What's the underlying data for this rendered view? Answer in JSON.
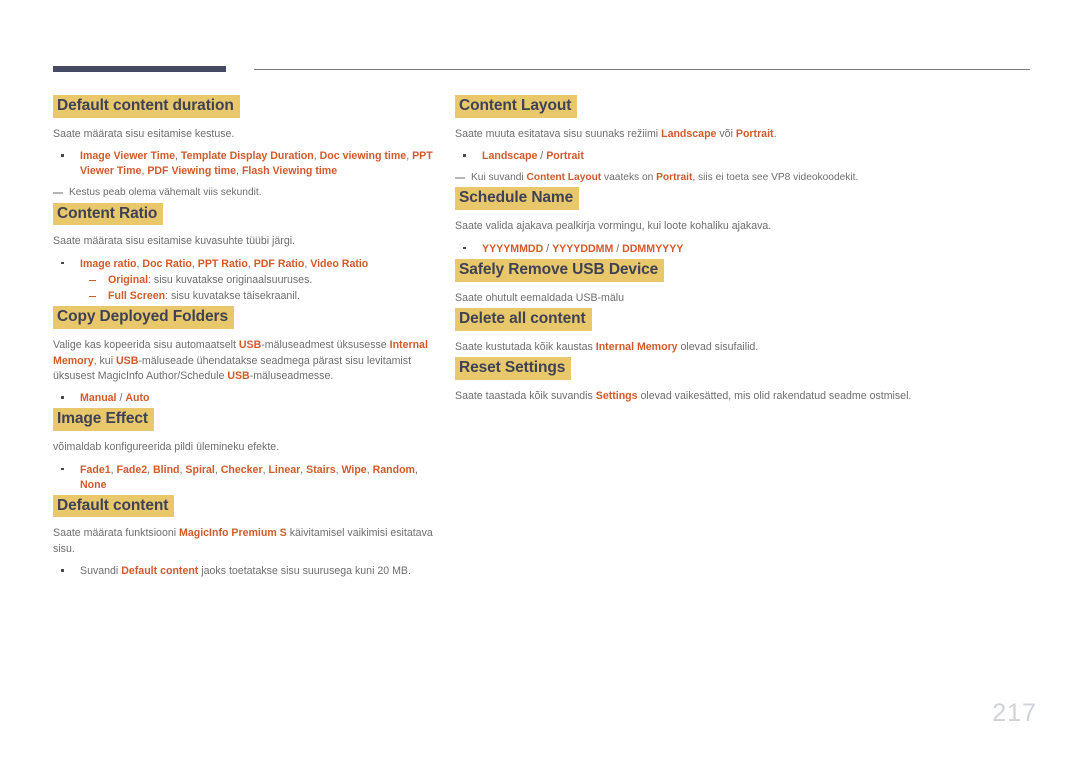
{
  "page": {
    "number": "217",
    "accent_highlight": "#e8c86a",
    "accent_emphasis": "#d35a2b",
    "heading_text_color": "#3f4257",
    "body_text_color": "#6e6e6e",
    "note_text_color": "#a9a9a9",
    "rule_thick_color": "#474a63",
    "rule_thin_color": "#77787c"
  },
  "left_column": [
    {
      "heading": "Default content duration",
      "body": "Saate määrata sisu esitamise kestuse.",
      "bullets": [
        {
          "parts": [
            {
              "t": "Image Viewer Time",
              "em": true
            },
            {
              "t": ", ",
              "em": false
            },
            {
              "t": "Template Display Duration",
              "em": true
            },
            {
              "t": ", ",
              "em": false
            },
            {
              "t": "Doc viewing time",
              "em": true
            },
            {
              "t": ", ",
              "em": false
            },
            {
              "t": "PPT Viewer Time",
              "em": true
            },
            {
              "t": ", ",
              "em": false
            },
            {
              "t": "PDF Viewing time",
              "em": true
            },
            {
              "t": ", ",
              "em": false
            },
            {
              "t": "Flash Viewing time",
              "em": true
            }
          ]
        }
      ],
      "note": [
        {
          "t": "Kestus peab olema vähemalt viis sekundit.",
          "em": false
        }
      ]
    },
    {
      "heading": "Content Ratio",
      "body": "Saate määrata sisu esitamise kuvasuhte tüübi järgi.",
      "bullets": [
        {
          "parts": [
            {
              "t": "Image ratio",
              "em": true
            },
            {
              "t": ", ",
              "em": false
            },
            {
              "t": "Doc Ratio",
              "em": true
            },
            {
              "t": ", ",
              "em": false
            },
            {
              "t": "PPT Ratio",
              "em": true
            },
            {
              "t": ", ",
              "em": false
            },
            {
              "t": "PDF Ratio",
              "em": true
            },
            {
              "t": ", ",
              "em": false
            },
            {
              "t": "Video Ratio",
              "em": true
            }
          ],
          "subbullets": [
            {
              "parts": [
                {
                  "t": "Original",
                  "em": true
                },
                {
                  "t": ": sisu kuvatakse originaalsuuruses.",
                  "em": false
                }
              ]
            },
            {
              "parts": [
                {
                  "t": "Full Screen",
                  "em": true
                },
                {
                  "t": ": sisu kuvatakse täisekraanil.",
                  "em": false
                }
              ]
            }
          ]
        }
      ]
    },
    {
      "heading": "Copy Deployed Folders",
      "body_parts": [
        {
          "t": "Valige kas kopeerida sisu automaatselt ",
          "em": false
        },
        {
          "t": "USB",
          "em": true
        },
        {
          "t": "-mäluseadmest üksusesse ",
          "em": false
        },
        {
          "t": "Internal Memory",
          "em": true
        },
        {
          "t": ", kui ",
          "em": false
        },
        {
          "t": "USB",
          "em": true
        },
        {
          "t": "-mäluseade ühendatakse seadmega pärast sisu levitamist üksusest MagicInfo Author/Schedule ",
          "em": false
        },
        {
          "t": "USB",
          "em": true
        },
        {
          "t": "-mäluseadmesse.",
          "em": false
        }
      ],
      "bullets": [
        {
          "parts": [
            {
              "t": "Manual",
              "em": true
            },
            {
              "t": " / ",
              "em": false
            },
            {
              "t": "Auto",
              "em": true
            }
          ]
        }
      ]
    },
    {
      "heading": "Image Effect",
      "body": "võimaldab konfigureerida pildi ülemineku efekte.",
      "bullets": [
        {
          "parts": [
            {
              "t": "Fade1",
              "em": true
            },
            {
              "t": ", ",
              "em": false
            },
            {
              "t": "Fade2",
              "em": true
            },
            {
              "t": ", ",
              "em": false
            },
            {
              "t": "Blind",
              "em": true
            },
            {
              "t": ", ",
              "em": false
            },
            {
              "t": "Spiral",
              "em": true
            },
            {
              "t": ", ",
              "em": false
            },
            {
              "t": "Checker",
              "em": true
            },
            {
              "t": ", ",
              "em": false
            },
            {
              "t": "Linear",
              "em": true
            },
            {
              "t": ", ",
              "em": false
            },
            {
              "t": "Stairs",
              "em": true
            },
            {
              "t": ", ",
              "em": false
            },
            {
              "t": "Wipe",
              "em": true
            },
            {
              "t": ", ",
              "em": false
            },
            {
              "t": "Random",
              "em": true
            },
            {
              "t": ", ",
              "em": false
            },
            {
              "t": "None",
              "em": true
            }
          ]
        }
      ]
    },
    {
      "heading": "Default content",
      "body_parts": [
        {
          "t": "Saate määrata funktsiooni ",
          "em": false
        },
        {
          "t": "MagicInfo Premium S",
          "em": true
        },
        {
          "t": " käivitamisel vaikimisi esitatava sisu.",
          "em": false
        }
      ],
      "bullets": [
        {
          "parts": [
            {
              "t": "Suvandi ",
              "em": false
            },
            {
              "t": "Default content",
              "em": true
            },
            {
              "t": " jaoks toetatakse sisu suurusega kuni 20 MB.",
              "em": false
            }
          ]
        }
      ]
    }
  ],
  "right_column": [
    {
      "heading": "Content Layout",
      "body_parts": [
        {
          "t": "Saate muuta esitatava sisu suunaks režiimi ",
          "em": false
        },
        {
          "t": "Landscape",
          "em": true
        },
        {
          "t": " või ",
          "em": false
        },
        {
          "t": "Portrait",
          "em": true
        },
        {
          "t": ".",
          "em": false
        }
      ],
      "bullets": [
        {
          "parts": [
            {
              "t": "Landscape",
              "em": true
            },
            {
              "t": " / ",
              "em": false
            },
            {
              "t": "Portrait",
              "em": true
            }
          ]
        }
      ],
      "note": [
        {
          "t": "Kui suvandi ",
          "em": false
        },
        {
          "t": "Content Layout",
          "em": true
        },
        {
          "t": " vaateks on ",
          "em": false
        },
        {
          "t": "Portrait",
          "em": true
        },
        {
          "t": ", siis ei toeta see VP8 videokoodekit.",
          "em": false
        }
      ]
    },
    {
      "heading": "Schedule Name",
      "body": "Saate valida ajakava pealkirja vormingu, kui loote kohaliku ajakava.",
      "bullets": [
        {
          "parts": [
            {
              "t": "YYYYMMDD",
              "em": true
            },
            {
              "t": " / ",
              "em": false
            },
            {
              "t": "YYYYDDMM",
              "em": true
            },
            {
              "t": " / ",
              "em": false
            },
            {
              "t": "DDMMYYYY",
              "em": true
            }
          ]
        }
      ]
    },
    {
      "heading": "Safely Remove USB Device",
      "body": "Saate ohutult eemaldada USB-mälu"
    },
    {
      "heading": "Delete all content",
      "body_parts": [
        {
          "t": "Saate kustutada kõik kaustas ",
          "em": false
        },
        {
          "t": "Internal Memory",
          "em": true
        },
        {
          "t": " olevad sisufailid.",
          "em": false
        }
      ]
    },
    {
      "heading": "Reset Settings",
      "body_parts": [
        {
          "t": "Saate taastada kõik suvandis ",
          "em": false
        },
        {
          "t": "Settings",
          "em": true
        },
        {
          "t": " olevad vaikesätted, mis olid rakendatud seadme ostmisel.",
          "em": false
        }
      ]
    }
  ]
}
